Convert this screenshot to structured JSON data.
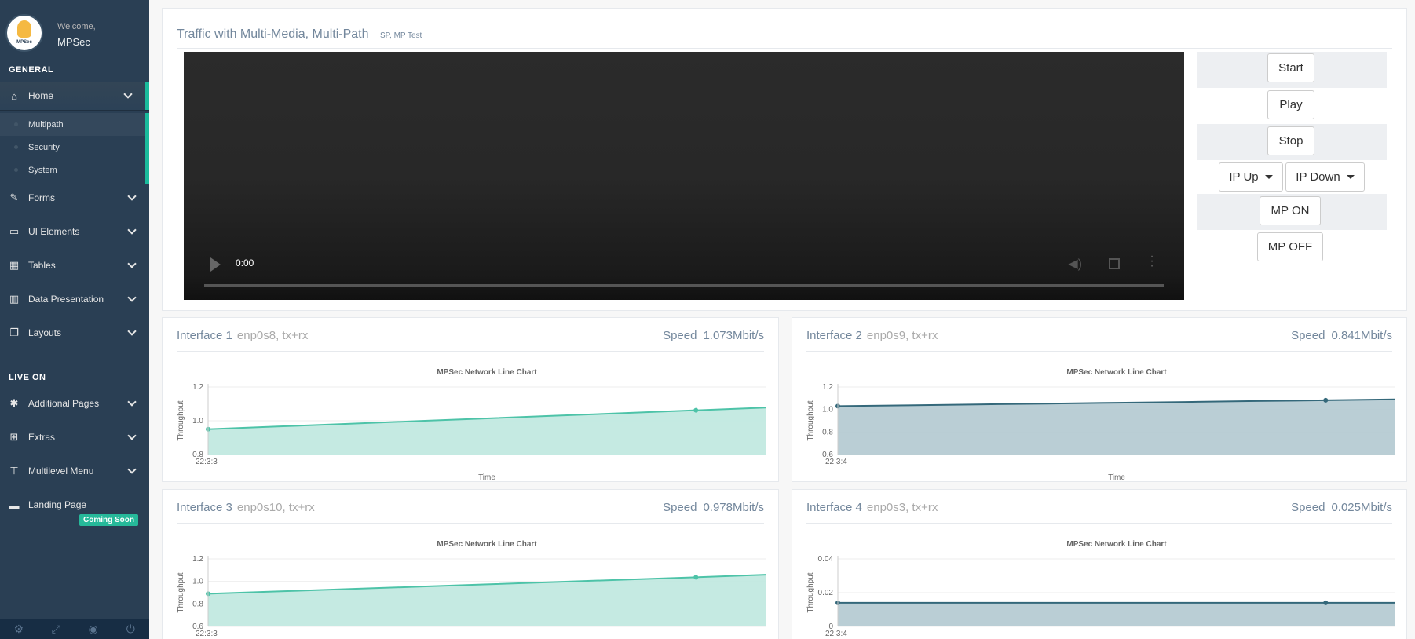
{
  "sidebar": {
    "welcome": "Welcome,",
    "username": "MPSec",
    "logo_text": "MPSec",
    "general_title": "GENERAL",
    "live_title": "LIVE ON",
    "items": [
      {
        "label": "Home",
        "icon": "home-icon"
      },
      {
        "label": "Forms",
        "icon": "edit-icon"
      },
      {
        "label": "UI Elements",
        "icon": "desktop-icon"
      },
      {
        "label": "Tables",
        "icon": "table-icon"
      },
      {
        "label": "Data Presentation",
        "icon": "bar-chart-icon"
      },
      {
        "label": "Layouts",
        "icon": "clone-icon"
      },
      {
        "label": "Additional Pages",
        "icon": "bug-icon"
      },
      {
        "label": "Extras",
        "icon": "windows-icon"
      },
      {
        "label": "Multilevel Menu",
        "icon": "sitemap-icon"
      },
      {
        "label": "Landing Page",
        "icon": "laptop-icon"
      }
    ],
    "home_sub": [
      "Multipath",
      "Security",
      "System"
    ],
    "coming_soon": "Coming Soon",
    "footer_icons": [
      "settings-icon",
      "fullscreen-icon",
      "lock-icon",
      "logout-icon"
    ]
  },
  "video_panel": {
    "title": "Traffic with Multi-Media, Multi-Path",
    "subtitle": "SP, MP Test",
    "time": "0:00",
    "buttons": {
      "start": "Start",
      "play": "Play",
      "stop": "Stop",
      "ip_up": "IP Up",
      "ip_down": "IP Down",
      "mp_on": "MP ON",
      "mp_off": "MP OFF"
    }
  },
  "interfaces": [
    {
      "name": "Interface 1",
      "detail": "enp0s8, tx+rx",
      "speed_label": "Speed",
      "speed": "1.073Mbit/s"
    },
    {
      "name": "Interface 2",
      "detail": "enp0s9, tx+rx",
      "speed_label": "Speed",
      "speed": "0.841Mbit/s"
    },
    {
      "name": "Interface 3",
      "detail": "enp0s10, tx+rx",
      "speed_label": "Speed",
      "speed": "0.978Mbit/s"
    },
    {
      "name": "Interface 4",
      "detail": "enp0s3, tx+rx",
      "speed_label": "Speed",
      "speed": "0.025Mbit/s"
    }
  ],
  "colors": {
    "sidebar": "#2A3F54",
    "accent": "#1ABB9C",
    "teal_fill": "#BFE8DF",
    "teal_line": "#4DC3A8",
    "slate_fill": "#B2C9D0",
    "slate_line": "#34687A"
  },
  "chart_data": [
    {
      "type": "area",
      "title": "MPSec Network Line Chart",
      "xlabel": "Time",
      "ylabel": "Throughput",
      "x": [
        "22:3:3",
        "",
        "",
        "",
        "",
        "",
        "",
        "",
        ""
      ],
      "y": [
        0.95,
        0.966,
        0.982,
        0.998,
        1.014,
        1.03,
        1.046,
        1.062,
        1.078
      ],
      "yticks": [
        "1.2",
        "1.0",
        "0.8"
      ],
      "ylim": [
        0.8,
        1.2
      ],
      "color": "#4DC3A8",
      "fill": "#BFE8DF"
    },
    {
      "type": "area",
      "title": "MPSec Network Line Chart",
      "xlabel": "Time",
      "ylabel": "Throughput",
      "x": [
        "22:3:4",
        "",
        "",
        "",
        "",
        "",
        "",
        "",
        ""
      ],
      "y": [
        1.03,
        1.037,
        1.045,
        1.052,
        1.06,
        1.067,
        1.075,
        1.082,
        1.09
      ],
      "yticks": [
        "1.2",
        "1.0",
        "0.8",
        "0.6"
      ],
      "ylim": [
        0.6,
        1.2
      ],
      "color": "#34687A",
      "fill": "#B2C9D0"
    },
    {
      "type": "area",
      "title": "MPSec Network Line Chart",
      "xlabel": "Time",
      "ylabel": "Throughput",
      "x": [
        "22:3:3",
        "",
        "",
        "",
        "",
        "",
        "",
        "",
        ""
      ],
      "y": [
        0.89,
        0.911,
        0.932,
        0.953,
        0.974,
        0.995,
        1.016,
        1.037,
        1.06
      ],
      "yticks": [
        "1.2",
        "1.0",
        "0.8",
        "0.6"
      ],
      "ylim": [
        0.6,
        1.2
      ],
      "color": "#4DC3A8",
      "fill": "#BFE8DF"
    },
    {
      "type": "area",
      "title": "MPSec Network Line Chart",
      "xlabel": "Time",
      "ylabel": "Throughput",
      "x": [
        "22:3:4",
        "",
        "",
        "",
        "",
        "",
        "",
        "",
        ""
      ],
      "y": [
        0.014,
        0.014,
        0.014,
        0.014,
        0.014,
        0.014,
        0.014,
        0.014,
        0.014
      ],
      "yticks": [
        "0.04",
        "0.02",
        "0"
      ],
      "ylim": [
        0,
        0.04
      ],
      "color": "#34687A",
      "fill": "#B2C9D0"
    }
  ]
}
